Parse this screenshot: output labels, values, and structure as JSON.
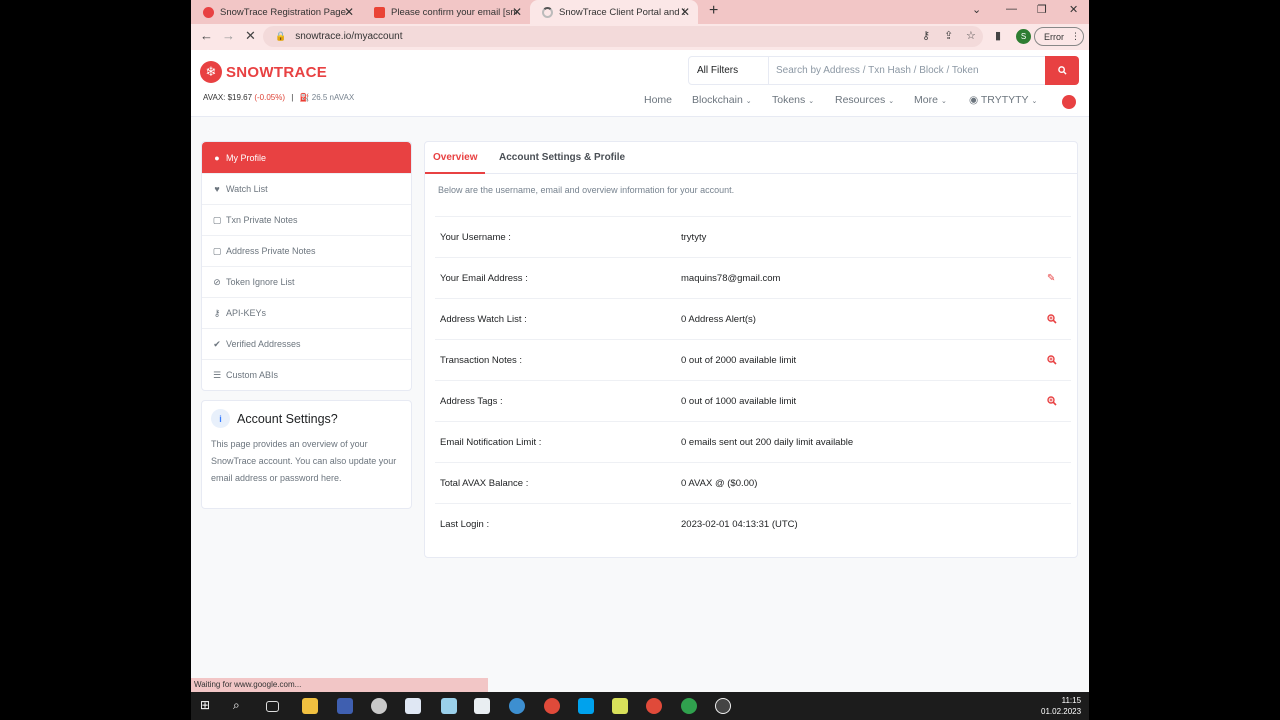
{
  "browser": {
    "tabs": [
      {
        "title": "SnowTrace Registration Page",
        "color": "#e84142"
      },
      {
        "title": "Please confirm your email [snowt",
        "color": "#ea4335"
      },
      {
        "title": "SnowTrace Client Portal and Serv",
        "color": "#bbbbbb"
      }
    ],
    "url": "snowtrace.io/myaccount",
    "profile_letter": "S",
    "error_label": "Error",
    "status_text": "Waiting for www.google.com..."
  },
  "site": {
    "logo_text": "SNOWTRACE",
    "price_label": "AVAX: $19.67",
    "price_change": "(-0.05%)",
    "separator": "|",
    "gas": "26.5 nAVAX",
    "filter_label": "All Filters",
    "search_placeholder": "Search by Address / Txn Hash / Block / Token",
    "nav": {
      "home": "Home",
      "blockchain": "Blockchain",
      "tokens": "Tokens",
      "resources": "Resources",
      "more": "More",
      "user": "TRYTYTY"
    }
  },
  "sidebar": {
    "items": [
      {
        "label": "My Profile",
        "icon": "user-circle-icon"
      },
      {
        "label": "Watch List",
        "icon": "heart-icon"
      },
      {
        "label": "Txn Private Notes",
        "icon": "sticky-note-icon"
      },
      {
        "label": "Address Private Notes",
        "icon": "sticky-note-icon"
      },
      {
        "label": "Token Ignore List",
        "icon": "eye-slash-icon"
      },
      {
        "label": "API-KEYs",
        "icon": "key-icon"
      },
      {
        "label": "Verified Addresses",
        "icon": "check-circle-icon"
      },
      {
        "label": "Custom ABIs",
        "icon": "list-icon"
      }
    ],
    "settings_title": "Account Settings?",
    "settings_text": "This page provides an overview of your SnowTrace account. You can also update your email address or password here."
  },
  "main": {
    "tabs": [
      "Overview",
      "Account Settings & Profile"
    ],
    "intro": "Below are the username, email and overview information for your account.",
    "rows": [
      {
        "label": "Your Username :",
        "value": "trytyty"
      },
      {
        "label": "Your Email Address :",
        "value": "maquins78@gmail.com"
      },
      {
        "label": "Address Watch List :",
        "value": "0 Address Alert(s)"
      },
      {
        "label": "Transaction Notes :",
        "value": "0 out of 2000 available limit"
      },
      {
        "label": "Address Tags :",
        "value": "0 out of 1000 available limit"
      },
      {
        "label": "Email Notification Limit :",
        "value": "0 emails sent out 200 daily limit available"
      },
      {
        "label": "Total AVAX Balance :",
        "value": "0 AVAX @ ($0.00)"
      },
      {
        "label": "Last Login :",
        "value": "2023-02-01 04:13:31 (UTC)"
      }
    ]
  },
  "taskbar": {
    "time": "11:15",
    "date": "01.02.2023"
  },
  "colors": {
    "brand": "#e84142",
    "muted": "#6c757e"
  }
}
